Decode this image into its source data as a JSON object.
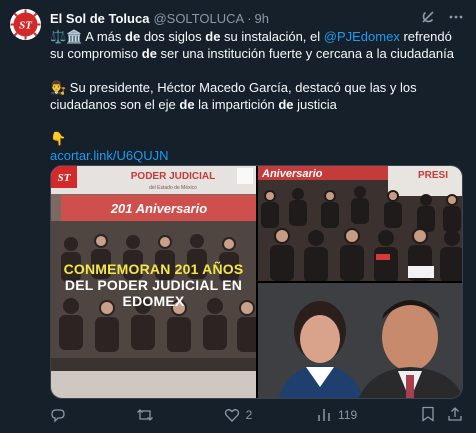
{
  "post": {
    "author_name": "El Sol de Toluca",
    "handle": "@SOLTOLUCA",
    "separator": "·",
    "time": "9h",
    "avatar_label": "ST",
    "line1_emoji": "⚖️🏛️",
    "line1_a": "A más ",
    "line1_b": "de",
    "line1_c": " dos siglos ",
    "line1_d": "de",
    "line1_e": " su instalación, el ",
    "mention": "@PJEdomex",
    "line1_f": " refrendó su compromiso ",
    "line1_g": "de",
    "line1_h": " ser una institución fuerte y cercana a la ciudadanía",
    "line2_emoji": "👨‍⚖️",
    "line2_a": " Su presidente, Héctor Macedo García, destacó que las y los ciudadanos son el eje ",
    "line2_b": "de",
    "line2_c": " la impartición ",
    "line2_d": "de",
    "line2_e": " justicia",
    "pointer_emoji": "👇",
    "link": "acortar.link/U6QUJN"
  },
  "media": {
    "left_logo": "ST",
    "left_banner_title": "PODER JUDICIAL",
    "left_banner_sub": "del Estado de México",
    "left_aniversario": "201 Aniversario",
    "overlay_line1": "CONMEMORAN 201 AÑOS",
    "overlay_line2": "DEL PODER JUDICIAL EN",
    "overlay_line3": "EDOMEX",
    "right_banner_left": "Aniversario",
    "right_banner_right": "PRESI"
  },
  "actions": {
    "reply_count": "",
    "repost_count": "",
    "like_count": "2",
    "views_count": "119"
  },
  "colors": {
    "background": "#15202b",
    "accent": "#1d9bf0",
    "muted": "#8b98a5",
    "overlay_yellow": "#f6e74a",
    "banner_red": "#c43b3b"
  }
}
